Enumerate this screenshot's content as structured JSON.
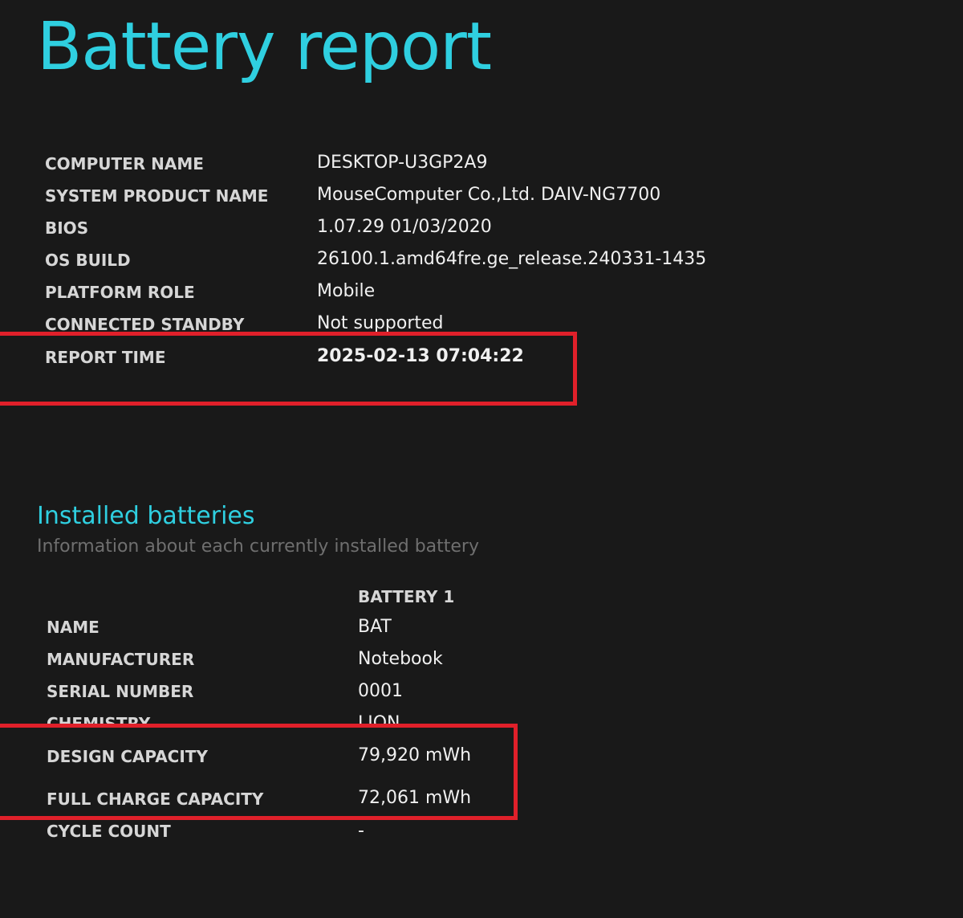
{
  "title": "Battery report",
  "system": [
    {
      "label": "COMPUTER NAME",
      "value": "DESKTOP-U3GP2A9"
    },
    {
      "label": "SYSTEM PRODUCT NAME",
      "value": "MouseComputer Co.,Ltd. DAIV-NG7700"
    },
    {
      "label": "BIOS",
      "value": "1.07.29 01/03/2020"
    },
    {
      "label": "OS BUILD",
      "value": "26100.1.amd64fre.ge_release.240331-1435"
    },
    {
      "label": "PLATFORM ROLE",
      "value": "Mobile"
    },
    {
      "label": "CONNECTED STANDBY",
      "value": "Not supported"
    },
    {
      "label": "REPORT TIME",
      "value": "2025-02-13  07:04:22"
    }
  ],
  "installed_batteries": {
    "title": "Installed batteries",
    "subtitle": "Information about each currently installed battery",
    "column_header": "BATTERY 1",
    "rows": [
      {
        "label": "NAME",
        "value": "BAT"
      },
      {
        "label": "MANUFACTURER",
        "value": "Notebook"
      },
      {
        "label": "SERIAL NUMBER",
        "value": "0001"
      },
      {
        "label": "CHEMISTRY",
        "value": "LION"
      },
      {
        "label": "DESIGN CAPACITY",
        "value": "79,920 mWh"
      },
      {
        "label": "FULL CHARGE CAPACITY",
        "value": "72,061 mWh"
      },
      {
        "label": "CYCLE COUNT",
        "value": "-"
      }
    ]
  },
  "colors": {
    "background": "#191919",
    "accent": "#2fcfe0",
    "highlight": "#e0202a"
  }
}
